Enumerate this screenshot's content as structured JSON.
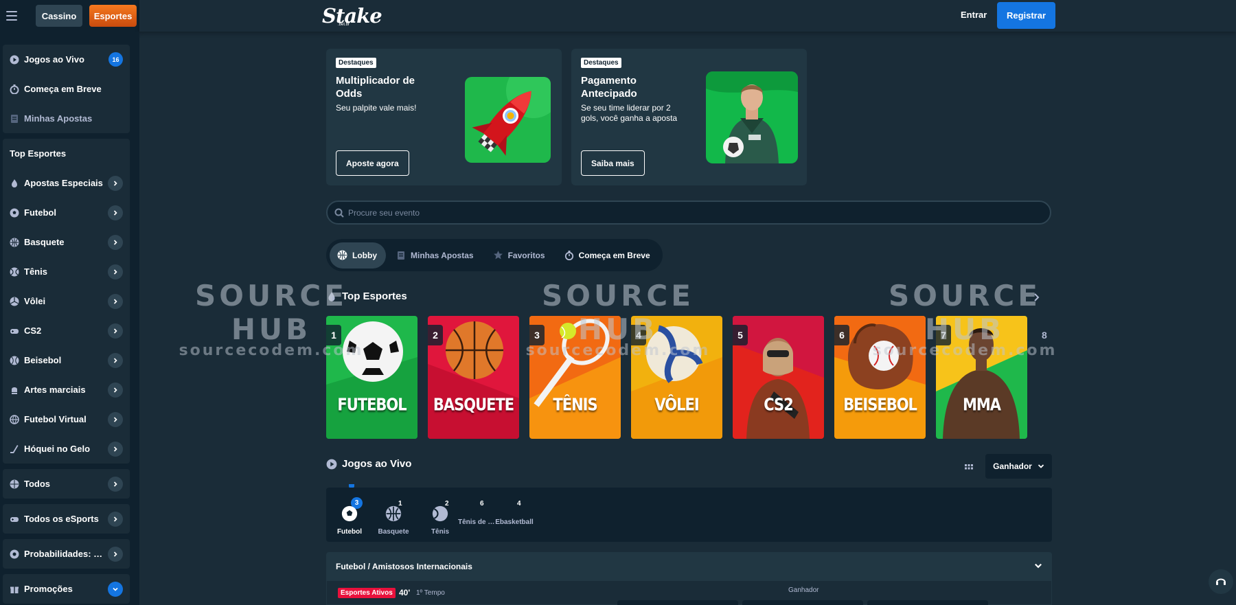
{
  "header": {
    "menu_icon": "hamburger-menu-icon",
    "casino_label": "Cassino",
    "sports_label": "Esportes",
    "logo_text": "Stake",
    "logo_sub": ".bet.br",
    "login_label": "Entrar",
    "register_label": "Registrar"
  },
  "sidebar": {
    "group1": [
      {
        "label": "Jogos ao Vivo",
        "icon": "play-circle-icon",
        "badge": "16"
      },
      {
        "label": "Começa em Breve",
        "icon": "stopwatch-icon"
      },
      {
        "label": "Minhas Apostas",
        "icon": "receipt-icon"
      }
    ],
    "top_heading": "Top Esportes",
    "top_sports": [
      {
        "label": "Apostas Especiais",
        "icon": "flame-icon"
      },
      {
        "label": "Futebol",
        "icon": "soccer-ball-icon"
      },
      {
        "label": "Basquete",
        "icon": "basketball-icon"
      },
      {
        "label": "Tênis",
        "icon": "tennis-ball-icon"
      },
      {
        "label": "Vôlei",
        "icon": "volleyball-icon"
      },
      {
        "label": "CS2",
        "icon": "gamepad-icon"
      },
      {
        "label": "Beisebol",
        "icon": "baseball-icon"
      },
      {
        "label": "Artes marciais",
        "icon": "glove-icon"
      },
      {
        "label": "Futebol Virtual",
        "icon": "globe-icon"
      },
      {
        "label": "Hóquei no Gelo",
        "icon": "hockey-stick-icon"
      }
    ],
    "all_sports": "Todos",
    "all_esports": "Todos os eSports",
    "odds": "Probabilidades: Decimal",
    "promotions": "Promoções"
  },
  "promos": [
    {
      "tag": "Destaques",
      "title": "Multiplicador de Odds",
      "desc": "Seu palpite vale mais!",
      "button": "Aposte agora",
      "image": "rocket-illustration"
    },
    {
      "tag": "Destaques",
      "title": "Pagamento Antecipado",
      "desc": "Se seu time liderar por 2 gols, você ganha a aposta",
      "button": "Saiba mais",
      "image": "goalkeeper-photo"
    }
  ],
  "search": {
    "placeholder": "Procure seu evento"
  },
  "tabs": [
    {
      "label": "Lobby",
      "icon": "basketball-icon"
    },
    {
      "label": "Minhas Apostas",
      "icon": "receipt-icon"
    },
    {
      "label": "Favoritos",
      "icon": "star-icon"
    },
    {
      "label": "Começa em Breve",
      "icon": "stopwatch-icon"
    }
  ],
  "top_sports_section": {
    "title": "Top Esportes",
    "cards": [
      {
        "rank": "1",
        "name": "FUTEBOL",
        "color": "#1fb84b"
      },
      {
        "rank": "2",
        "name": "BASQUETE",
        "color": "#e0163c"
      },
      {
        "rank": "3",
        "name": "TÊNIS",
        "color": "#f7930f"
      },
      {
        "rank": "4",
        "name": "VÔLEI",
        "color": "#f2b10e"
      },
      {
        "rank": "5",
        "name": "CS2",
        "color": "#e2231d"
      },
      {
        "rank": "6",
        "name": "BEISEBOL",
        "color": "#f59b0b"
      },
      {
        "rank": "7",
        "name": "MMA",
        "color": "#1fb84b"
      }
    ],
    "next_rank": "8"
  },
  "live_section": {
    "title": "Jogos ao Vivo",
    "market_select": "Ganhador",
    "sports": [
      {
        "count": "3",
        "label": "Futebol",
        "icon": "soccer-ball-icon",
        "active": true
      },
      {
        "count": "1",
        "label": "Basquete",
        "icon": "basketball-icon"
      },
      {
        "count": "2",
        "label": "Tênis",
        "icon": "tennis-ball-icon"
      },
      {
        "count": "6",
        "label": "Tênis de Mesa",
        "icon": ""
      },
      {
        "count": "4",
        "label": "Ebasketball",
        "icon": ""
      }
    ],
    "league": "Futebol / Amistosos Internacionais",
    "match": {
      "status": "Esportes Ativos",
      "minute": "40'",
      "period": "1º Tempo",
      "market_label": "Ganhador"
    }
  },
  "watermark": {
    "title": "SOURCE HUB",
    "url": "sourcecodem.com"
  },
  "colors": {
    "accent_blue": "#1475e1",
    "sports_orange": "#f5791f",
    "bg": "#1a2c38",
    "panel": "#0f212e"
  }
}
